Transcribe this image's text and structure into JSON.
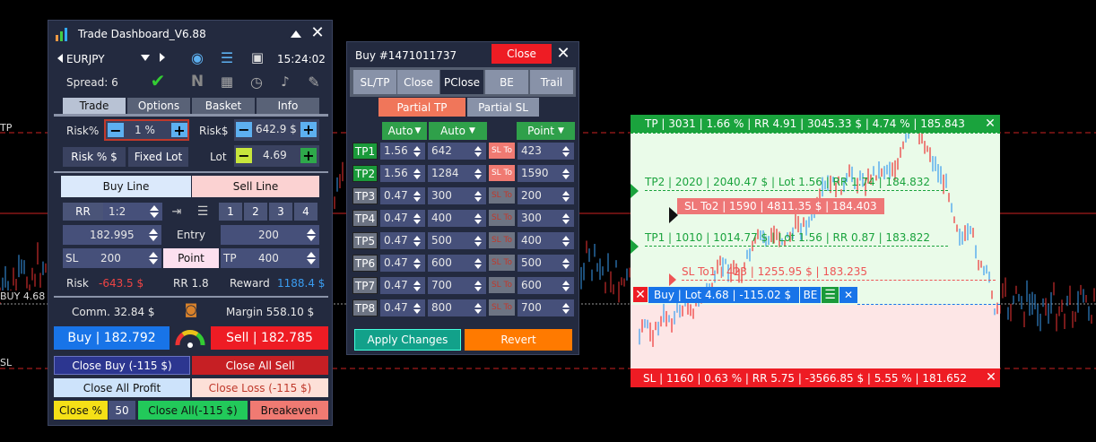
{
  "colors": {
    "accent_green": "#22a447",
    "accent_red": "#ee1c24",
    "accent_blue": "#1874e8",
    "panel": "#232a3f",
    "field": "#46507a"
  },
  "chart_levels": {
    "tp": "TP",
    "buy": "BUY 4.68",
    "sl": "SL"
  },
  "dashboard": {
    "title": "Trade Dashboard_V6.88",
    "symbol": "EURJPY",
    "time": "15:24:02",
    "spread": "Spread: 6",
    "tabs": [
      "Trade",
      "Options",
      "Basket",
      "Info"
    ],
    "risk_pct_label": "Risk%",
    "risk_pct_value": "1 %",
    "risk_usd_label": "Risk$",
    "risk_usd_value": "642.9 $",
    "risk_pct_usd_btn": "Risk % $",
    "fixed_lot_btn": "Fixed Lot",
    "lot_label": "Lot",
    "lot_value": "4.69",
    "buy_line": "Buy Line",
    "sell_line": "Sell Line",
    "rr_label": "RR",
    "rr_value": "1:2",
    "rr_buttons": [
      "1",
      "2",
      "3",
      "4"
    ],
    "entry_price": "182.995",
    "entry_label": "Entry",
    "entry_points": "200",
    "sl_label": "SL",
    "sl_value": "200",
    "point_btn": "Point",
    "tp_label": "TP",
    "tp_value": "400",
    "risk_label": "Risk",
    "risk_amount": "-643.5 $",
    "rr_text": "RR 1.8",
    "reward_label": "Reward",
    "reward_amount": "1188.4 $",
    "comm": "Comm. 32.84 $",
    "margin": "Margin 558.10 $",
    "buy_btn": "Buy | 182.792",
    "sell_btn": "Sell | 182.785",
    "close_buy": "Close Buy (-115 $)",
    "close_all_sell": "Close All Sell",
    "close_all_profit": "Close All Profit",
    "close_loss": "Close Loss (-115 $)",
    "close_pct": "Close %",
    "close_pct_value": "50",
    "close_all": "Close All(-115 $)",
    "breakeven": "Breakeven"
  },
  "trade_panel": {
    "title": "Buy #1471011737",
    "close_btn": "Close",
    "tabs": [
      "SL/TP",
      "Close",
      "PClose",
      "BE",
      "Trail"
    ],
    "partial_tp": "Partial TP",
    "partial_sl": "Partial SL",
    "auto1": "Auto",
    "auto2": "Auto",
    "point": "Point",
    "sl_to": "SL To",
    "rows": [
      {
        "label": "TP1",
        "lot": "1.56",
        "pts": "642",
        "sl": "423",
        "active": true
      },
      {
        "label": "TP2",
        "lot": "1.56",
        "pts": "1284",
        "sl": "1590",
        "active": true
      },
      {
        "label": "TP3",
        "lot": "0.47",
        "pts": "300",
        "sl": "200",
        "active": false
      },
      {
        "label": "TP4",
        "lot": "0.47",
        "pts": "400",
        "sl": "300",
        "active": false
      },
      {
        "label": "TP5",
        "lot": "0.47",
        "pts": "500",
        "sl": "400",
        "active": false
      },
      {
        "label": "TP6",
        "lot": "0.47",
        "pts": "600",
        "sl": "500",
        "active": false
      },
      {
        "label": "TP7",
        "lot": "0.47",
        "pts": "700",
        "sl": "600",
        "active": false
      },
      {
        "label": "TP8",
        "lot": "0.47",
        "pts": "800",
        "sl": "700",
        "active": false
      }
    ],
    "apply": "Apply Changes",
    "revert": "Revert"
  },
  "overlay": {
    "tp_bar": "TP | 3031 | 1.66 % | RR 4.91 | 3045.33 $ | 4.74 % | 185.843",
    "tp2": "TP2 | 2020 | 2040.47 $ | Lot 1.56 | RR 1.74 | 184.832",
    "sl_to2": "SL To2 | 1590 | 4811.35 $ | 184.403",
    "tp1": "TP1 | 1010 | 1014.77 $ | Lot 1.56 | RR 0.87 | 183.822",
    "sl_to1": "SL To1 | 423 | 1255.95 $ | 183.235",
    "buy_bar": "Buy | Lot 4.68 | -115.02 $",
    "be": "BE",
    "sl_bar": "SL | 1160 | 0.63 % | RR 5.75 | -3566.85 $ | 5.55 % | 181.652"
  }
}
